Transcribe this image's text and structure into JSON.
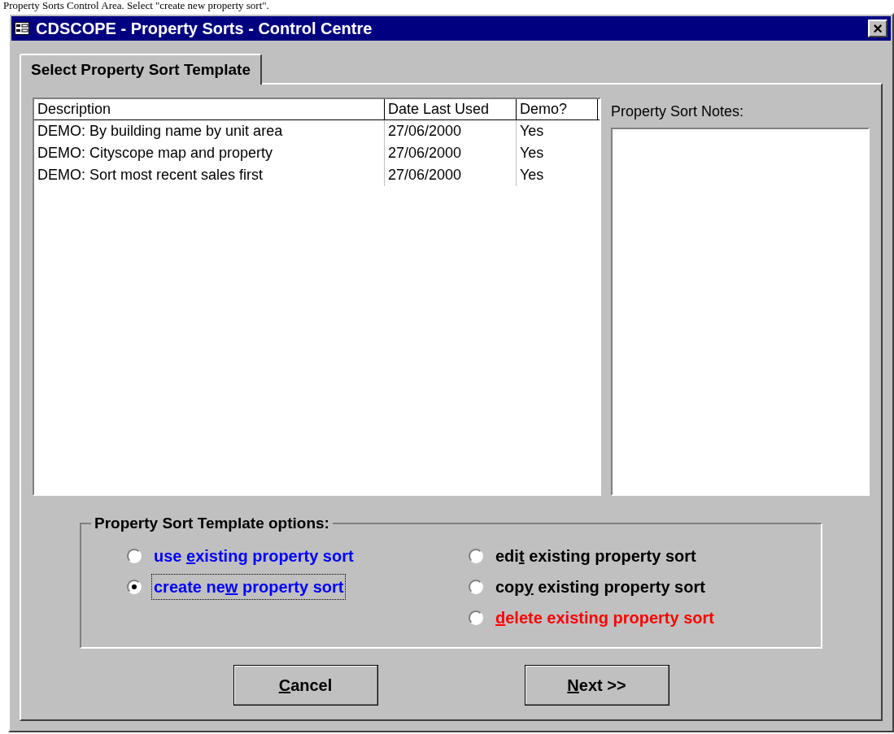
{
  "caption": "Property Sorts Control Area. Select \"create new property sort\".",
  "window": {
    "title": "CDSCOPE - Property Sorts - Control Centre",
    "close": "×"
  },
  "tabs": [
    {
      "label": "Select Property Sort Template",
      "selected": true
    }
  ],
  "table": {
    "columns": [
      "Description",
      "Date Last Used",
      "Demo?"
    ],
    "rows": [
      [
        "DEMO: By building name by unit area",
        "27/06/2000",
        "Yes"
      ],
      [
        "DEMO: Cityscope map and property",
        "27/06/2000",
        "Yes"
      ],
      [
        "DEMO: Sort most recent sales first",
        "27/06/2000",
        "Yes"
      ]
    ]
  },
  "notes": {
    "label": "Property Sort Notes:"
  },
  "options": {
    "title": "Property Sort Template options:",
    "columns": [
      [
        {
          "label_parts": [
            "use ",
            "e",
            "xisting property sort"
          ],
          "color": "#0000ff",
          "selected": false,
          "focused": false
        },
        {
          "label_parts": [
            "create ne",
            "w",
            " property sort"
          ],
          "color": "#0000ff",
          "selected": true,
          "focused": true
        }
      ],
      [
        {
          "label_parts": [
            "edi",
            "t",
            " existing property sort"
          ],
          "color": "#000000",
          "selected": false,
          "focused": false
        },
        {
          "label_parts": [
            "cop",
            "y",
            " existing property sort"
          ],
          "color": "#000000",
          "selected": false,
          "focused": false
        },
        {
          "label_parts": [
            "d",
            "elete existing property sort"
          ],
          "mnemonic_first": true,
          "color": "#ff0000",
          "selected": false,
          "focused": false
        }
      ]
    ]
  },
  "buttons": [
    {
      "label_parts": [
        "C",
        "ancel"
      ],
      "mnemonic_first": true
    },
    {
      "label_parts": [
        "N",
        "ext >>"
      ],
      "mnemonic_first": true
    }
  ]
}
